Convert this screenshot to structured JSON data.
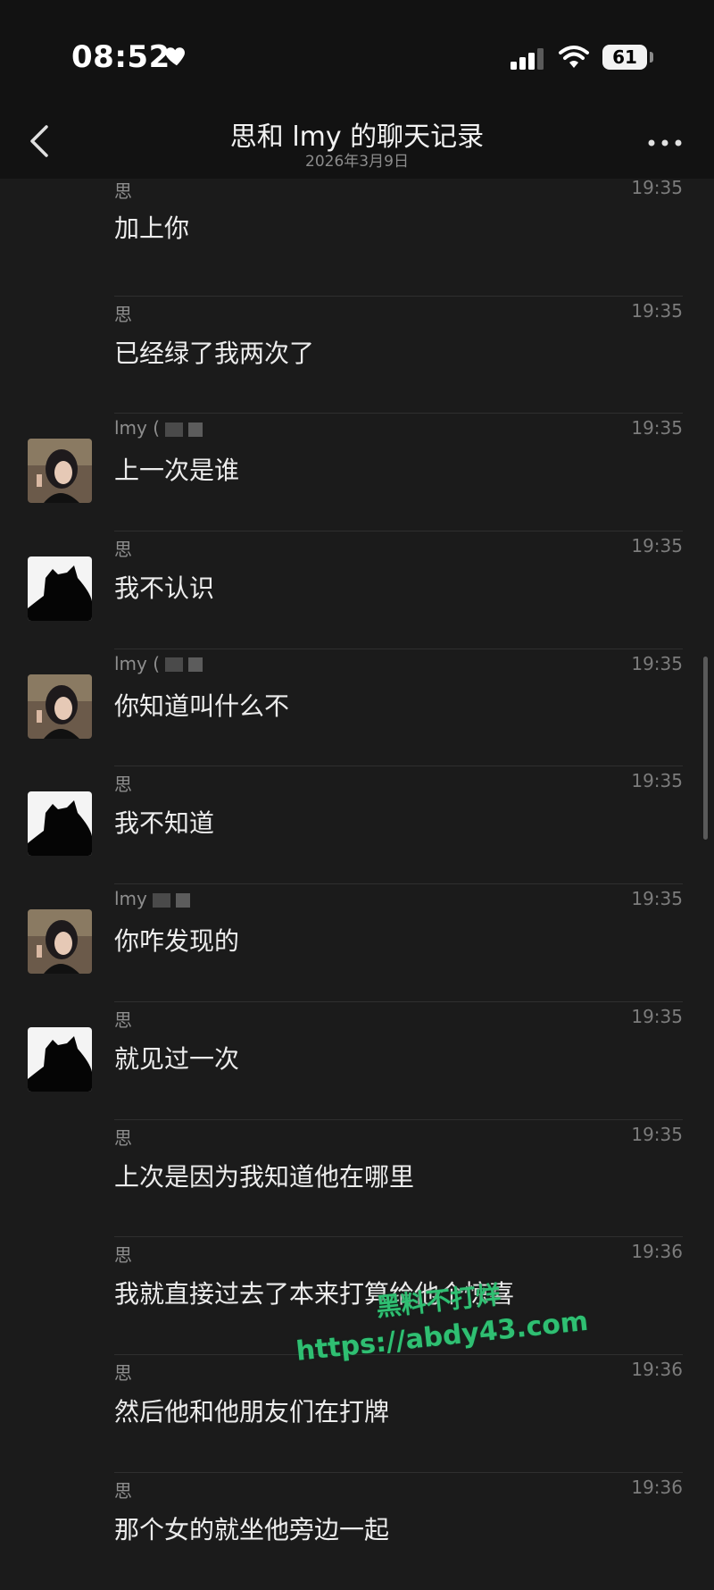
{
  "status_bar": {
    "time": "08:52",
    "battery": "61"
  },
  "header": {
    "title": "思和 lmy 的聊天记录",
    "subtitle": "2026年3月9日"
  },
  "messages": [
    {
      "sender": "思",
      "time": "19:35",
      "text": "加上你",
      "avatar": "none"
    },
    {
      "sender": "思",
      "time": "19:35",
      "text": "已经绿了我两次了",
      "avatar": "none"
    },
    {
      "sender": "lmy (",
      "time": "19:35",
      "text": "上一次是谁",
      "avatar": "girl"
    },
    {
      "sender": "思",
      "time": "19:35",
      "text": "我不认识",
      "avatar": "cat"
    },
    {
      "sender": "lmy (",
      "time": "19:35",
      "text": "你知道叫什么不",
      "avatar": "girl"
    },
    {
      "sender": "思",
      "time": "19:35",
      "text": "我不知道",
      "avatar": "cat"
    },
    {
      "sender": "lmy",
      "time": "19:35",
      "text": "你咋发现的",
      "avatar": "girl"
    },
    {
      "sender": "思",
      "time": "19:35",
      "text": "就见过一次",
      "avatar": "cat"
    },
    {
      "sender": "思",
      "time": "19:35",
      "text": "上次是因为我知道他在哪里",
      "avatar": "none"
    },
    {
      "sender": "思",
      "time": "19:36",
      "text": "我就直接过去了本来打算给他个惊喜",
      "avatar": "none"
    },
    {
      "sender": "思",
      "time": "19:36",
      "text": "然后他和他朋友们在打牌",
      "avatar": "none"
    },
    {
      "sender": "思",
      "time": "19:36",
      "text": "那个女的就坐他旁边一起",
      "avatar": "none"
    }
  ],
  "watermark": {
    "line1": "黑料不打烊",
    "url": "https://abdy43.com"
  },
  "icons": {
    "back": "chevron-left-icon",
    "more": "more-dots-icon",
    "heart": "heart-icon",
    "signal": "cellular-signal-icon",
    "wifi": "wifi-icon"
  },
  "colors": {
    "background": "#1b1b1b",
    "header": "#121212",
    "watermark": "#2fbf72"
  }
}
